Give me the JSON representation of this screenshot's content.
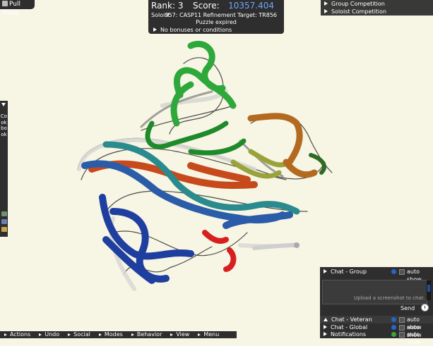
{
  "header": {
    "pull_mode": "Pull Mode"
  },
  "score_panel": {
    "rank": "Rank: 3",
    "score_label": "Score:",
    "score_value": "10357.404",
    "mode": "Soloist",
    "puzzle": "957: CASP11 Refinement Target: TR856",
    "status": "Puzzle expired",
    "bonus": "No bonuses or conditions",
    "score_color": "#6ea6ff"
  },
  "competition": {
    "items": [
      "Group Competition",
      "Soloist Competition"
    ]
  },
  "cookbook": {
    "label": "Cookbook"
  },
  "bottom_bar": {
    "items": [
      "Actions",
      "Undo",
      "Social",
      "Modes",
      "Behavior",
      "View",
      "Menu"
    ]
  },
  "chat": {
    "group_tab": "Chat - Group",
    "auto_show": "auto show",
    "upload_hint": "Upload a screenshot to chat.",
    "send": "Send",
    "tabs": [
      "Chat - Veteran",
      "Chat - Global",
      "Notifications"
    ]
  },
  "colors": {
    "background": "#f7f5e4",
    "panel": "#2e2e2e",
    "info_icon": "#2a63c9"
  }
}
